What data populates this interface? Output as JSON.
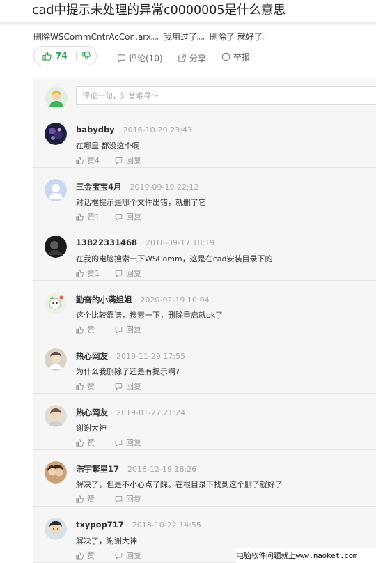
{
  "page": {
    "title": "cad中提示未处理的异常c0000005是什么意思",
    "answer_text": "删除WSCommCntrAcCon.arx。。我用过了。。删除了 就好了。"
  },
  "votes": {
    "up_count": "74",
    "up_icon": "thumbs-up-icon",
    "down_icon": "thumbs-down-icon"
  },
  "actions": {
    "comment_label": "评论(10)",
    "share_label": "分享",
    "report_label": "举报"
  },
  "comment_box": {
    "placeholder": "评论一句，知音难寻～"
  },
  "comments": [
    {
      "name": "babydby",
      "time": "2016-10-20 23:43",
      "text": "在哪里 都没这个啊",
      "like": "赞4",
      "reply": "回复"
    },
    {
      "name": "三金宝宝4月",
      "time": "2019-09-19 22:12",
      "text": "对话框提示是哪个文件出错，就删了它",
      "like": "赞1",
      "reply": "回复"
    },
    {
      "name": "13822331468",
      "time": "2018-09-17 18:19",
      "text": "在我的电脑搜索一下WSComm，这是在cad安装目录下的",
      "like": "赞1",
      "reply": "回复"
    },
    {
      "name": "勤奋的小满姐姐",
      "time": "2020-02-19 10:04",
      "text": "这个比较靠谱，搜索一下，删除重启就ok了",
      "like": "赞",
      "reply": "回复"
    },
    {
      "name": "热心网友",
      "time": "2019-11-29 17:55",
      "text": "为什么我删除了还是有提示啊?",
      "like": "赞",
      "reply": "回复"
    },
    {
      "name": "热心网友",
      "time": "2019-01-27 21:24",
      "text": "谢谢大神",
      "like": "赞",
      "reply": "回复"
    },
    {
      "name": "浩宇繁星17",
      "time": "2018-12-19 18:26",
      "text": "解决了，但是不小心点了踩。在根目录下找到这个删了就好了",
      "like": "赞",
      "reply": "回复"
    },
    {
      "name": "txypop717",
      "time": "2018-10-22 14:55",
      "text": "解决了，谢谢大神",
      "like": "赞",
      "reply": "回复"
    }
  ],
  "watermark": "电脑软件问题就上www.naoket.com",
  "colors": {
    "accent_green": "#2aa34a",
    "panel_bg": "#f6f6f6",
    "muted": "#a7a7a7"
  }
}
